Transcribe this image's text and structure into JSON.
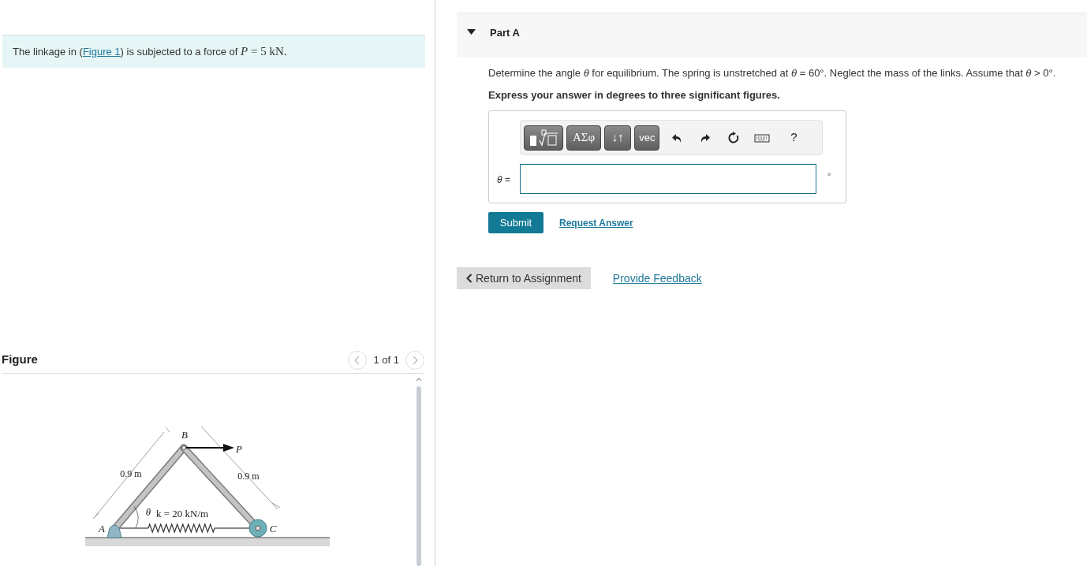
{
  "problem": {
    "before": "The linkage in (",
    "link": "Figure 1",
    "after": ") is subjected to a force of ",
    "math": "*P* = 5 kN."
  },
  "figure_panel": {
    "title": "Figure",
    "pager": "1 of 1",
    "prev_disabled": true,
    "next_disabled": true,
    "labels": [
      {
        "kind": "point",
        "text": "B"
      },
      {
        "kind": "force",
        "text": "P"
      },
      {
        "kind": "length",
        "text": "0.9 m"
      },
      {
        "kind": "length",
        "text": "0.9 m"
      },
      {
        "kind": "angle",
        "text": "θ"
      },
      {
        "kind": "spring",
        "text": "k = 20 kN/m"
      },
      {
        "kind": "point",
        "text": "A"
      },
      {
        "kind": "point",
        "text": "C"
      }
    ]
  },
  "part": {
    "title": "Part A",
    "expanded": true,
    "question": "Determine the angle *θ* for equilibrium. The spring is unstretched at *θ* = 60°. Neglect the mass of the links. Assume that *θ* > 0°.",
    "instruction": "Express your answer in degrees to three significant figures.",
    "toolbar": [
      {
        "kind": "template"
      },
      {
        "kind": "text",
        "text": "ΑΣφ"
      },
      {
        "kind": "text",
        "text": "↓↑"
      },
      {
        "kind": "text",
        "text": "vec"
      },
      {
        "kind": "undo"
      },
      {
        "kind": "redo"
      },
      {
        "kind": "reset"
      },
      {
        "kind": "keyboard"
      },
      {
        "kind": "help",
        "text": "?"
      }
    ],
    "answer_label": "θ =",
    "unit": "°",
    "submit": "Submit",
    "request": "Request Answer"
  },
  "footer": {
    "return": "Return to Assignment",
    "feedback": "Provide Feedback"
  }
}
